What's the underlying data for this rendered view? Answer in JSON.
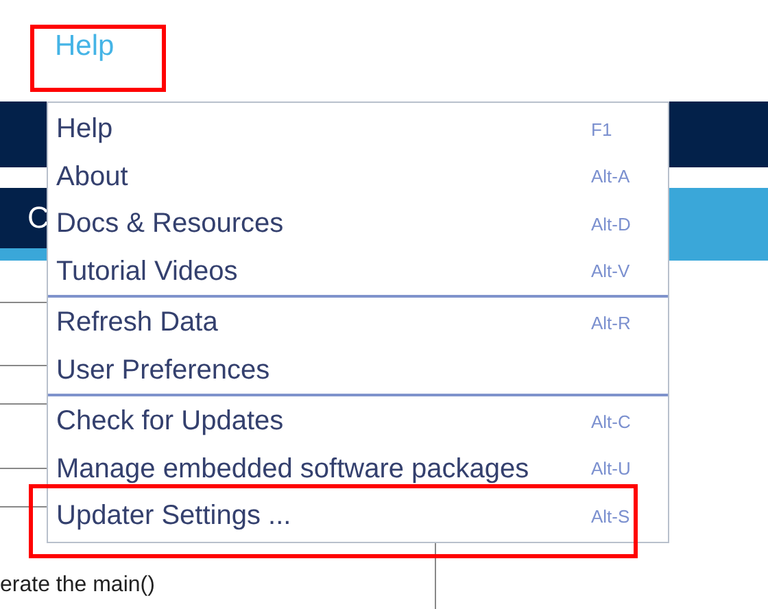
{
  "menu_bar": {
    "label": "Help",
    "highlighted": true
  },
  "background": {
    "header_letter": "C",
    "text": "erate the main()"
  },
  "menu": {
    "groups": [
      [
        {
          "label": "Help",
          "shortcut": "F1",
          "highlighted": false
        },
        {
          "label": "About",
          "shortcut": "Alt-A",
          "highlighted": false
        },
        {
          "label": "Docs & Resources",
          "shortcut": "Alt-D",
          "highlighted": false
        },
        {
          "label": "Tutorial Videos",
          "shortcut": "Alt-V",
          "highlighted": false
        }
      ],
      [
        {
          "label": "Refresh Data",
          "shortcut": "Alt-R",
          "highlighted": false
        },
        {
          "label": "User Preferences",
          "highlighted": false
        }
      ],
      [
        {
          "label": "Check for Updates",
          "shortcut": "Alt-C",
          "highlighted": false
        },
        {
          "label": "Manage embedded software packages",
          "shortcut": "Alt-U",
          "highlighted": false
        },
        {
          "label": "Updater Settings ...",
          "shortcut": "Alt-S",
          "highlighted": true
        }
      ]
    ]
  }
}
